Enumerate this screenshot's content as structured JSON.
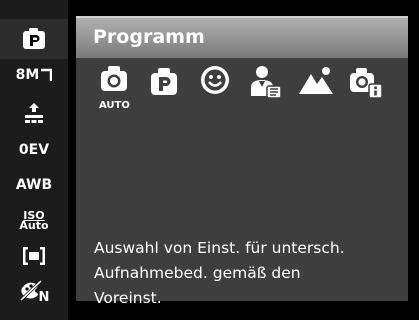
{
  "sidebar": {
    "items": [
      {
        "icon": "program-mode-icon",
        "active": true
      },
      {
        "icon": "resolution-8m-icon",
        "label": "8M"
      },
      {
        "icon": "quality-icon"
      },
      {
        "icon": "exposure-icon",
        "label": "0EV"
      },
      {
        "icon": "white-balance-icon",
        "label": "AWB"
      },
      {
        "icon": "iso-icon",
        "label_top": "ISO",
        "label_bottom": "Auto"
      },
      {
        "icon": "metering-icon"
      },
      {
        "icon": "color-mode-icon",
        "label": "N"
      }
    ]
  },
  "panel": {
    "title": "Programm",
    "modes": [
      {
        "icon": "auto-camera-icon",
        "label": "AUTO"
      },
      {
        "icon": "program-icon"
      },
      {
        "icon": "smile-icon"
      },
      {
        "icon": "portrait-icon"
      },
      {
        "icon": "landscape-icon"
      },
      {
        "icon": "camera-info-icon"
      }
    ],
    "description": [
      "Auswahl von Einst. für untersch.",
      "Aufnahmebed. gemäß den",
      "Voreinst."
    ]
  },
  "colors": {
    "background": "#000000",
    "sidebar": "#1c1c1c",
    "panel": "#3e3e3e",
    "title_bar": "#8a8a8a",
    "text": "#ffffff"
  }
}
